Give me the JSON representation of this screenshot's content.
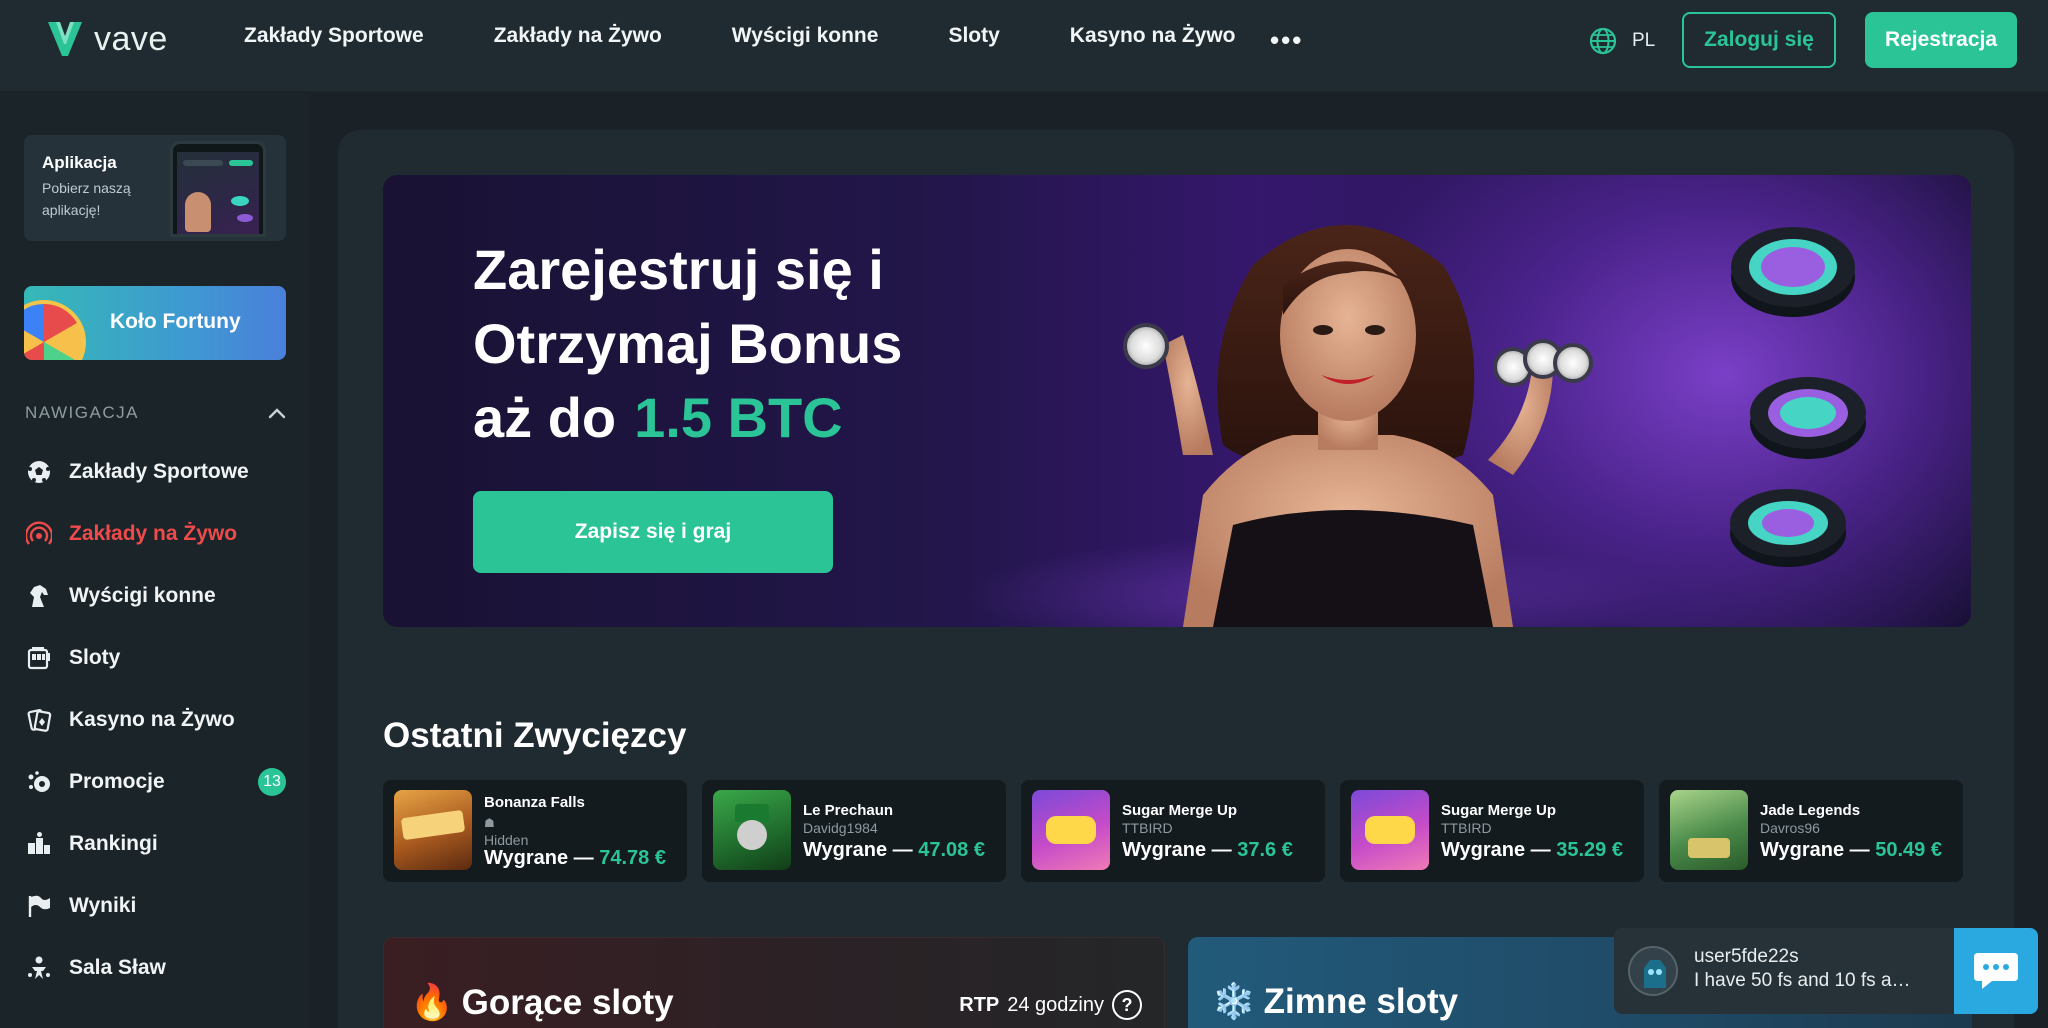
{
  "header": {
    "logo_text": "vave",
    "nav": [
      "Zakłady Sportowe",
      "Zakłady na Żywo",
      "Wyścigi konne",
      "Sloty",
      "Kasyno na Żywo"
    ],
    "more": "•••",
    "language": "PL",
    "login_label": "Zaloguj się",
    "register_label": "Rejestracja"
  },
  "sidebar": {
    "app_card": {
      "title": "Aplikacja",
      "subtitle": "Pobierz naszą aplikację!"
    },
    "fortune_label": "Koło Fortuny",
    "nav_heading": "NAWIGACJA",
    "items": [
      {
        "label": "Zakłady Sportowe",
        "icon": "soccer-ball-icon"
      },
      {
        "label": "Zakłady na Żywo",
        "icon": "live-broadcast-icon",
        "active": true
      },
      {
        "label": "Wyścigi konne",
        "icon": "horse-icon"
      },
      {
        "label": "Sloty",
        "icon": "slot-machine-icon"
      },
      {
        "label": "Kasyno na Żywo",
        "icon": "cards-icon"
      },
      {
        "label": "Promocje",
        "icon": "promo-icon",
        "badge": "13"
      },
      {
        "label": "Rankingi",
        "icon": "ranking-icon"
      },
      {
        "label": "Wyniki",
        "icon": "flag-icon"
      },
      {
        "label": "Sala Sław",
        "icon": "hall-of-fame-icon"
      }
    ]
  },
  "hero": {
    "line1": "Zarejestruj się i",
    "line2": "Otrzymaj Bonus",
    "line3_prefix": "aż do",
    "line3_accent": "1.5 BTC",
    "cta_label": "Zapisz się i graj"
  },
  "winners": {
    "title": "Ostatni Zwycięzcy",
    "amount_prefix": "Wygrane —",
    "cards": [
      {
        "game": "Bonanza Falls",
        "user": "Hidden",
        "amount": "74.78 €"
      },
      {
        "game": "Le Prechaun",
        "user": "Davidg1984",
        "amount": "47.08 €"
      },
      {
        "game": "Sugar Merge Up",
        "user": "TTBIRD",
        "amount": "37.6 €"
      },
      {
        "game": "Sugar Merge Up",
        "user": "TTBIRD",
        "amount": "35.29 €"
      },
      {
        "game": "Jade Legends",
        "user": "Davros96",
        "amount": "50.49 €"
      }
    ]
  },
  "hot_slots": {
    "emoji": "🔥",
    "title": "Gorące sloty",
    "rtp_label": "RTP",
    "rtp_period": "24 godziny",
    "help": "?"
  },
  "cold_slots": {
    "emoji": "❄️",
    "title": "Zimne sloty"
  },
  "chat": {
    "user": "user5fde22s",
    "message": "I have 50 fs and 10 fs a…"
  },
  "colors": {
    "accent": "#2bc497",
    "live": "#ef4b4b",
    "chat": "#2aa9e0"
  }
}
